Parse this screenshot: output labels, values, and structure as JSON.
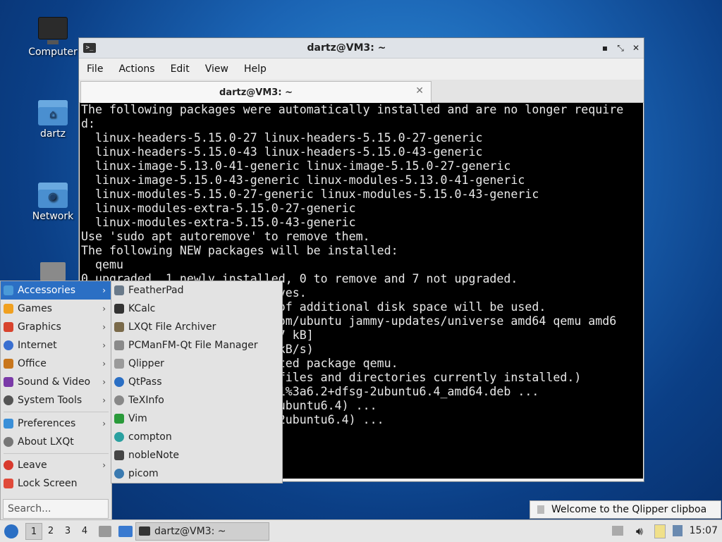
{
  "desktop": {
    "icons": [
      {
        "label": "Computer"
      },
      {
        "label": "dartz"
      },
      {
        "label": "Network"
      }
    ]
  },
  "window": {
    "title": "dartz@VM3: ~",
    "menus": [
      "File",
      "Actions",
      "Edit",
      "View",
      "Help"
    ],
    "tab_label": "dartz@VM3: ~",
    "terminal_lines": [
      "The following packages were automatically installed and are no longer require",
      "d:",
      "  linux-headers-5.15.0-27 linux-headers-5.15.0-27-generic",
      "  linux-headers-5.15.0-43 linux-headers-5.15.0-43-generic",
      "  linux-image-5.13.0-41-generic linux-image-5.15.0-27-generic",
      "  linux-image-5.15.0-43-generic linux-modules-5.13.0-41-generic",
      "  linux-modules-5.15.0-27-generic linux-modules-5.15.0-43-generic",
      "  linux-modules-extra-5.15.0-27-generic",
      "  linux-modules-extra-5.15.0-43-generic",
      "Use 'sudo apt autoremove' to remove them.",
      "The following NEW packages will be installed:",
      "  qemu",
      "0 upgraded, 1 newly installed, 0 to remove and 7 not upgraded.",
      "                            ves.",
      "                            of additional disk space will be used.",
      "                            om/ubuntu jammy-updates/universe amd64 qemu amd6",
      "                            7 kB]",
      "                            kB/s)",
      "                            ted package qemu.",
      "                            files and directories currently installed.)",
      "                            1%3a6.2+dfsg-2ubuntu6.4_amd64.deb ...",
      "                            ubuntu6.4) ...",
      "                            2ubuntu6.4) ..."
    ]
  },
  "main_menu": {
    "items": [
      {
        "label": "Accessories",
        "icon": "accessories-icon",
        "color": "#4a9ad8",
        "submenu": true,
        "selected": true
      },
      {
        "label": "Games",
        "icon": "games-icon",
        "color": "#f0a020",
        "submenu": true
      },
      {
        "label": "Graphics",
        "icon": "graphics-icon",
        "color": "#d8442e",
        "submenu": true
      },
      {
        "label": "Internet",
        "icon": "internet-icon",
        "color": "#3a6fd0",
        "submenu": true
      },
      {
        "label": "Office",
        "icon": "office-icon",
        "color": "#c8761c",
        "submenu": true
      },
      {
        "label": "Sound & Video",
        "icon": "sound-video-icon",
        "color": "#7a3aa8",
        "submenu": true
      },
      {
        "label": "System Tools",
        "icon": "system-tools-icon",
        "color": "#555555",
        "submenu": true
      },
      {
        "label": "Preferences",
        "icon": "preferences-icon",
        "color": "#3a8fd8",
        "submenu": true
      },
      {
        "label": "About LXQt",
        "icon": "about-icon",
        "color": "#777777",
        "submenu": false
      },
      {
        "label": "Leave",
        "icon": "leave-icon",
        "color": "#d83a2e",
        "submenu": true
      },
      {
        "label": "Lock Screen",
        "icon": "lock-icon",
        "color": "#e04a3a",
        "submenu": false
      }
    ],
    "search_placeholder": "Search..."
  },
  "submenu": {
    "items": [
      {
        "label": "FeatherPad",
        "icon": "featherpad-icon",
        "color": "#6a7a8a"
      },
      {
        "label": "KCalc",
        "icon": "kcalc-icon",
        "color": "#333333"
      },
      {
        "label": "LXQt File Archiver",
        "icon": "archiver-icon",
        "color": "#7a6a4a"
      },
      {
        "label": "PCManFM-Qt File Manager",
        "icon": "file-manager-icon",
        "color": "#8a8a8a"
      },
      {
        "label": "Qlipper",
        "icon": "qlipper-icon",
        "color": "#9a9a9a"
      },
      {
        "label": "QtPass",
        "icon": "qtpass-icon",
        "color": "#2b6fc4"
      },
      {
        "label": "TeXInfo",
        "icon": "texinfo-icon",
        "color": "#888888"
      },
      {
        "label": "Vim",
        "icon": "vim-icon",
        "color": "#2a9a3a"
      },
      {
        "label": "compton",
        "icon": "compton-icon",
        "color": "#2aa0a0"
      },
      {
        "label": "nobleNote",
        "icon": "noblenote-icon",
        "color": "#444444"
      },
      {
        "label": "picom",
        "icon": "picom-icon",
        "color": "#3a7ab0"
      }
    ]
  },
  "taskbar": {
    "workspaces": [
      "1",
      "2",
      "3",
      "4"
    ],
    "task_label": "dartz@VM3: ~",
    "clock": "15:07"
  },
  "notification": {
    "text": "Welcome to the Qlipper clipboa"
  }
}
